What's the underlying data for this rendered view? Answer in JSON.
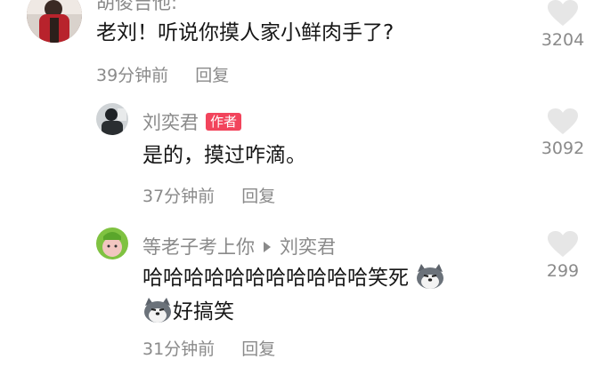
{
  "comments": [
    {
      "name": "胡俊吉他:",
      "text": "老刘！听说你摸人家小鲜肉手了?",
      "time": "39分钟前",
      "reply": "回复",
      "likes": "3204"
    },
    {
      "name": "刘奕君",
      "badge": "作者",
      "text": "是的，摸过咋滴。",
      "time": "37分钟前",
      "reply": "回复",
      "likes": "3092"
    },
    {
      "name": "等老子考上你",
      "reply_to": "刘奕君",
      "text_line1": "哈哈哈哈哈哈哈哈哈哈哈笑死",
      "text_line2": "好搞笑",
      "emoji": "husky-emoji",
      "time": "31分钟前",
      "reply": "回复",
      "likes": "299"
    }
  ],
  "colors": {
    "text": "#161616",
    "muted": "#8a8a8a",
    "badge": "#f2445c",
    "heart": "#e6e6e6"
  },
  "icons": {
    "like": "heart-icon",
    "reply_to": "triangle-right-icon",
    "emoji": "husky-emoji"
  }
}
